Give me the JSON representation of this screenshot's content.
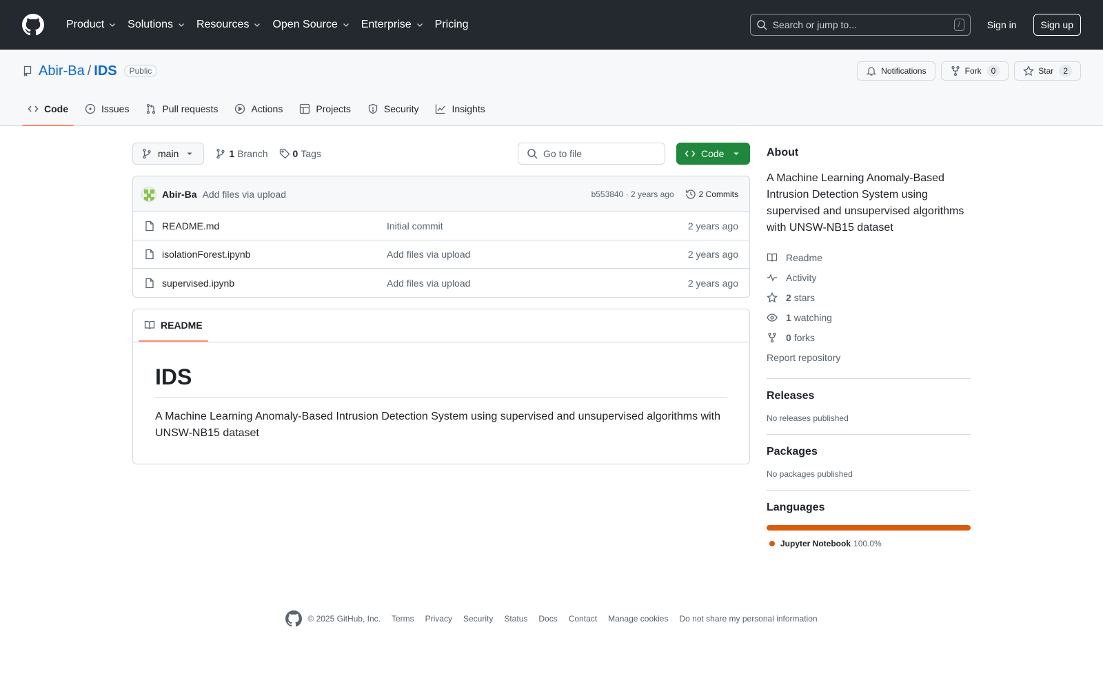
{
  "header": {
    "nav": [
      "Product",
      "Solutions",
      "Resources",
      "Open Source",
      "Enterprise",
      "Pricing"
    ],
    "search_placeholder": "Search or jump to...",
    "search_shortcut": "/",
    "sign_in": "Sign in",
    "sign_up": "Sign up"
  },
  "repo": {
    "owner": "Abir-Ba",
    "separator": "/",
    "name": "IDS",
    "visibility": "Public",
    "notifications_label": "Notifications",
    "fork_label": "Fork",
    "fork_count": "0",
    "star_label": "Star",
    "star_count": "2"
  },
  "tabs": [
    "Code",
    "Issues",
    "Pull requests",
    "Actions",
    "Projects",
    "Security",
    "Insights"
  ],
  "toolbar": {
    "branch": "main",
    "branch_count": "1",
    "branch_label": "Branch",
    "tag_count": "0",
    "tag_label": "Tags",
    "goto_placeholder": "Go to file",
    "code_button": "Code"
  },
  "latest_commit": {
    "author": "Abir-Ba",
    "message": "Add files via upload",
    "meta": "b553840 · 2 years ago",
    "commits": "2 Commits"
  },
  "files": [
    {
      "name": "README.md",
      "message": "Initial commit",
      "age": "2 years ago"
    },
    {
      "name": "isolationForest.ipynb",
      "message": "Add files via upload",
      "age": "2 years ago"
    },
    {
      "name": "supervised.ipynb",
      "message": "Add files via upload",
      "age": "2 years ago"
    }
  ],
  "readme": {
    "tab": "README",
    "title": "IDS",
    "body": "A Machine Learning Anomaly-Based Intrusion Detection System using supervised and unsupervised algorithms with UNSW-NB15 dataset"
  },
  "sidebar": {
    "about_heading": "About",
    "about_text": "A Machine Learning Anomaly-Based Intrusion Detection System using supervised and unsupervised algorithms with UNSW-NB15 dataset",
    "readme": "Readme",
    "activity": "Activity",
    "stars_count": "2",
    "stars_label": "stars",
    "watching_count": "1",
    "watching_label": "watching",
    "forks_count": "0",
    "forks_label": "forks",
    "report": "Report repository",
    "releases_heading": "Releases",
    "releases_text": "No releases published",
    "packages_heading": "Packages",
    "packages_text": "No packages published",
    "languages_heading": "Languages",
    "language_name": "Jupyter Notebook",
    "language_pct": "100.0%",
    "language_color": "#DA5B0B"
  },
  "footer": {
    "copyright": "© 2025 GitHub, Inc.",
    "links": [
      "Terms",
      "Privacy",
      "Security",
      "Status",
      "Docs",
      "Contact",
      "Manage cookies",
      "Do not share my personal information"
    ]
  }
}
